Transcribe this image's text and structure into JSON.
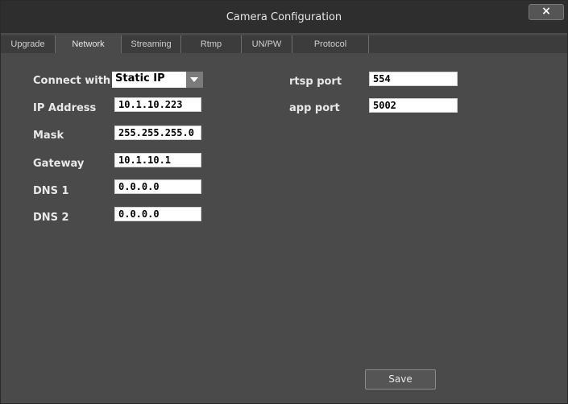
{
  "window": {
    "title": "Camera Configuration",
    "close_label": "×"
  },
  "tabs": [
    {
      "label": "Upgrade",
      "active": false
    },
    {
      "label": "Network",
      "active": true
    },
    {
      "label": "Streaming",
      "active": false
    },
    {
      "label": "Rtmp",
      "active": false
    },
    {
      "label": "UN/PW",
      "active": false
    },
    {
      "label": "Protocol",
      "active": false
    }
  ],
  "network": {
    "connect_with": {
      "label": "Connect with",
      "value": "Static IP"
    },
    "ip_address": {
      "label": "IP Address",
      "value": "10.1.10.223"
    },
    "mask": {
      "label": "Mask",
      "value": "255.255.255.0"
    },
    "gateway": {
      "label": "Gateway",
      "value": "10.1.10.1"
    },
    "dns1": {
      "label": "DNS 1",
      "value": "0.0.0.0"
    },
    "dns2": {
      "label": "DNS 2",
      "value": "0.0.0.0"
    },
    "rtsp_port": {
      "label": "rtsp port",
      "value": "554"
    },
    "app_port": {
      "label": "app port",
      "value": "5002"
    }
  },
  "buttons": {
    "save_label": "Save"
  },
  "colors": {
    "background": "#4a4a4a",
    "titlebar": "#2e2e2e",
    "field": "#ffffff"
  },
  "icons": {
    "close": "close-icon",
    "dropdown": "chevron-down-icon"
  }
}
